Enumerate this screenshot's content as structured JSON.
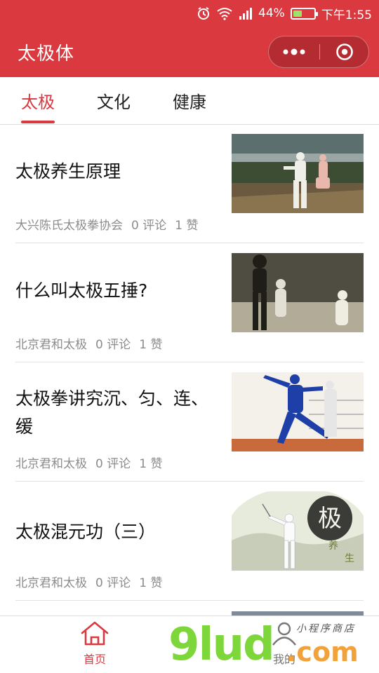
{
  "status": {
    "battery": "44%",
    "time": "下午1:55",
    "battery_level": 0.44,
    "icons": [
      "alarm-icon",
      "wifi-icon",
      "signal-icon",
      "battery-icon"
    ]
  },
  "nav": {
    "title": "太极体",
    "more_icon": "more-dots-icon",
    "close_icon": "target-close-icon"
  },
  "tabs": [
    {
      "label": "太极",
      "active": true
    },
    {
      "label": "文化",
      "active": false
    },
    {
      "label": "健康",
      "active": false
    }
  ],
  "articles": [
    {
      "title": "太极养生原理",
      "source": "大兴陈氏太极拳协会",
      "comments": "0 评论",
      "likes": "1 赞"
    },
    {
      "title": "什么叫太极五捶?",
      "source": "北京君和太极",
      "comments": "0 评论",
      "likes": "1 赞"
    },
    {
      "title": "太极拳讲究沉、匀、连、缓",
      "source": "北京君和太极",
      "comments": "0 评论",
      "likes": "1 赞"
    },
    {
      "title": "太极混元功（三）",
      "source": "北京君和太极",
      "comments": "0 评论",
      "likes": "1 赞"
    }
  ],
  "thumb4_text": {
    "big": "极",
    "small1": "养",
    "small2": "生"
  },
  "bottom": {
    "home_label": "首页",
    "mine_label": "我的"
  },
  "watermark": {
    "text1": "9lud",
    "text2": ".com",
    "text3": "小程序商店"
  },
  "colors": {
    "brand_red": "#d9393f",
    "watermark_green": "#7dd63a",
    "watermark_orange": "#f2a23a"
  }
}
